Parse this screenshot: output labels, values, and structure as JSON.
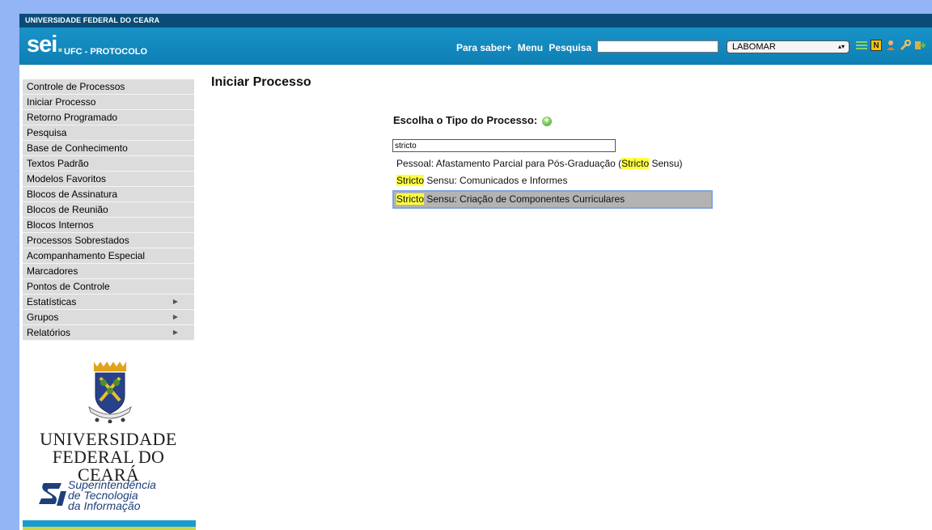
{
  "header": {
    "university_banner": "UNIVERSIDADE FEDERAL DO CEARA",
    "app_logo": "sei",
    "app_logo_dot": ".",
    "app_subtitle": "UFC - PROTOCOLO",
    "nav": {
      "para_saber": "Para saber+",
      "menu": "Menu",
      "pesquisa": "Pesquisa"
    },
    "search_value": "",
    "unit_selected": "LABOMAR",
    "icons": [
      "list-icon",
      "n-badge-icon",
      "user-icon",
      "wrench-icon",
      "exit-icon"
    ]
  },
  "sidebar": {
    "items": [
      {
        "label": "Controle de Processos"
      },
      {
        "label": "Iniciar Processo"
      },
      {
        "label": "Retorno Programado"
      },
      {
        "label": "Pesquisa"
      },
      {
        "label": "Base de Conhecimento"
      },
      {
        "label": "Textos Padrão"
      },
      {
        "label": "Modelos Favoritos"
      },
      {
        "label": "Blocos de Assinatura"
      },
      {
        "label": "Blocos de Reunião"
      },
      {
        "label": "Blocos Internos"
      },
      {
        "label": "Processos Sobrestados"
      },
      {
        "label": "Acompanhamento Especial"
      },
      {
        "label": "Marcadores"
      },
      {
        "label": "Pontos de Controle"
      },
      {
        "label": "Estatísticas",
        "submenu": true
      },
      {
        "label": "Grupos",
        "submenu": true
      },
      {
        "label": "Relatórios",
        "submenu": true
      }
    ],
    "university_line1": "UNIVERSIDADE",
    "university_line2": "FEDERAL DO CEARÁ",
    "sti_line1": "Superintendência",
    "sti_line2": "de Tecnologia",
    "sti_line3": "da Informação"
  },
  "main": {
    "title": "Iniciar Processo",
    "choose_label": "Escolha o Tipo do Processo:",
    "filter_value": "stricto",
    "results": [
      {
        "pre": "Pessoal: Afastamento Parcial para Pós-Graduação (",
        "highlight": "Stricto",
        "post": " Sensu)"
      },
      {
        "pre": "",
        "highlight": "Stricto",
        "post": " Sensu: Comunicados e Informes"
      },
      {
        "pre": "",
        "highlight": "Stricto",
        "post": " Sensu: Criação de Componentes Curriculares",
        "selected": true
      }
    ]
  },
  "colors": {
    "header_blue": "#1893c8",
    "banner_dark_blue": "#0a4c77",
    "menu_gray": "#dcdcdc",
    "highlight_yellow": "#ffff40",
    "selected_gray": "#b3b3b3"
  }
}
